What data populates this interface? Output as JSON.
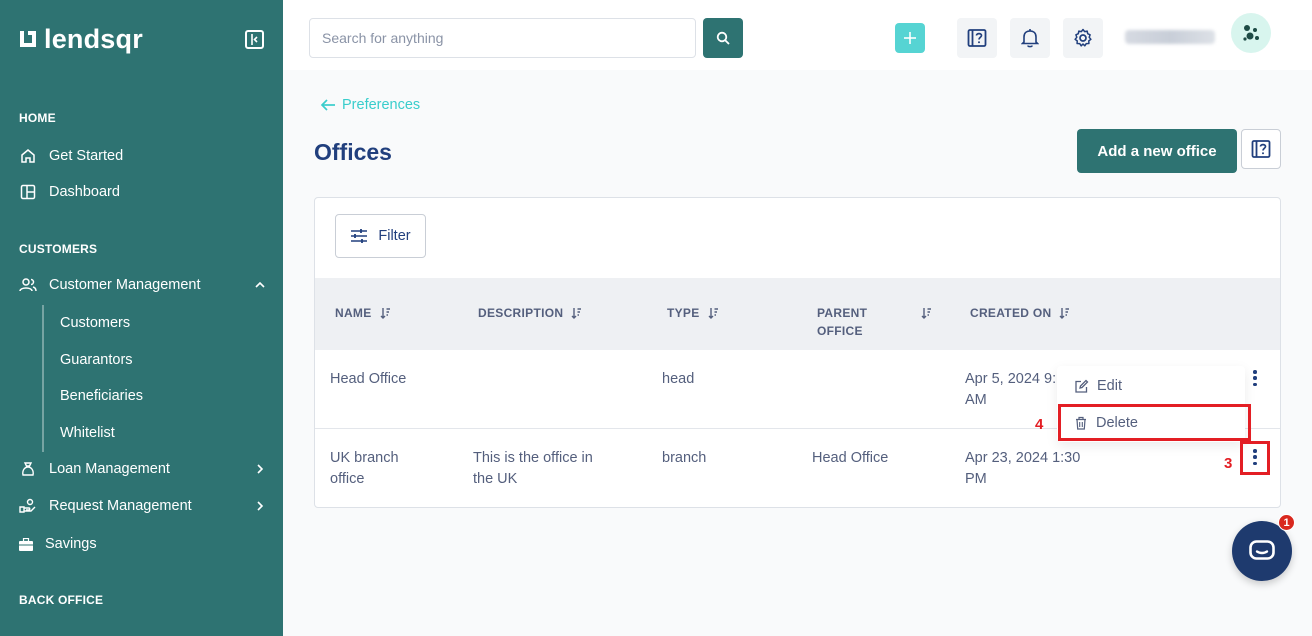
{
  "brand": {
    "name": "lendsqr"
  },
  "sidebar": {
    "sections": {
      "home": "HOME",
      "customers": "CUSTOMERS",
      "back_office": "BACK OFFICE"
    },
    "items": {
      "get_started": "Get Started",
      "dashboard": "Dashboard",
      "customer_management": "Customer Management",
      "loan_management": "Loan Management",
      "request_management": "Request Management",
      "savings": "Savings"
    },
    "customer_subitems": [
      "Customers",
      "Guarantors",
      "Beneficiaries",
      "Whitelist"
    ]
  },
  "header": {
    "search_placeholder": "Search for anything"
  },
  "breadcrumb": {
    "back_label": "Preferences"
  },
  "page": {
    "title": "Offices",
    "add_button": "Add a new office"
  },
  "table": {
    "filter_label": "Filter",
    "columns": [
      "NAME",
      "DESCRIPTION",
      "TYPE",
      "PARENT\nOFFICE",
      "CREATED ON"
    ],
    "rows": [
      {
        "name": "Head Office",
        "description": "",
        "type": "head",
        "parent_office": "",
        "created_on": "Apr 5, 2024 9:\nAM"
      },
      {
        "name": "UK branch\noffice",
        "description": "This is the office in\nthe UK",
        "type": "branch",
        "parent_office": "Head Office",
        "created_on": "Apr 23, 2024 1:30\nPM"
      }
    ]
  },
  "row_menu": {
    "edit": "Edit",
    "delete": "Delete"
  },
  "annotations": {
    "delete_marker": "4",
    "kebab_marker": "3"
  },
  "chat": {
    "badge_count": "1"
  },
  "colors": {
    "sidebar": "#2e7372",
    "accent": "#39cdcc",
    "primary_text": "#213f7d",
    "annotation": "#e31e24"
  }
}
